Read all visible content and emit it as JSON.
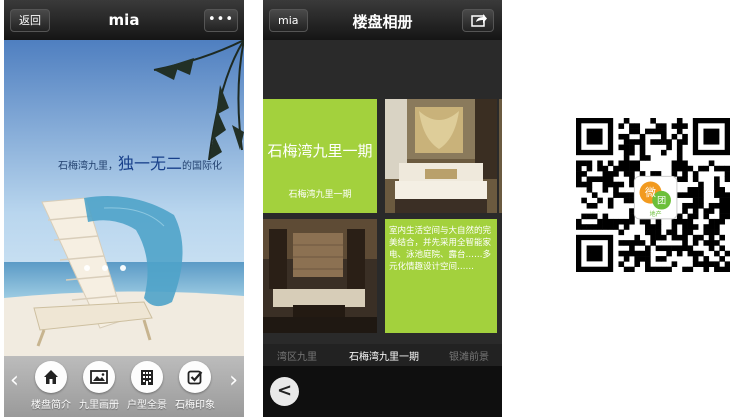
{
  "phone1": {
    "nav": {
      "back_label": "返回",
      "title": "mia",
      "more_label": "•••"
    },
    "headline": {
      "pre": "石梅湾九里，",
      "big": "独一无二",
      "post": "的国际化"
    },
    "toolbar": {
      "prev_arrow": "‹",
      "next_arrow": "›",
      "items": [
        {
          "label": "楼盘简介",
          "icon": "home-icon"
        },
        {
          "label": "九里画册",
          "icon": "picture-icon"
        },
        {
          "label": "户型全景",
          "icon": "building-icon"
        },
        {
          "label": "石梅印象",
          "icon": "checkbox-icon"
        }
      ]
    }
  },
  "phone2": {
    "nav": {
      "back_label": "mia",
      "title": "楼盘相册"
    },
    "tile_title": "石梅湾九里一期",
    "tile_sub": "石梅湾九里一期",
    "tile_text": "室内生活空间与大自然的完美结合，并先采用全智能家电、泳池庭院、露台……多元化情趣设计空间……",
    "tabs": [
      "湾区九里",
      "石梅湾九里一期",
      "银滩前景"
    ],
    "back_circle": "<"
  },
  "qr": {
    "center_text_1": "微",
    "center_text_2": "团",
    "center_caption": "地产"
  },
  "colors": {
    "accent_green": "#a3d13d",
    "navbar": "#1f1f1f",
    "sky": "#9ec4e6"
  }
}
